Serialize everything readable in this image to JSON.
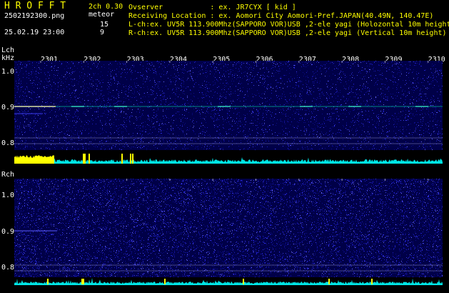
{
  "header": {
    "brand": "H R O F F T",
    "version": "2ch 0.30",
    "filename": "2502192300.png",
    "mode_label": "meteor",
    "count_lch": "15",
    "count_rch": "9",
    "datetime": "25.02.19 23:00"
  },
  "info": {
    "observer": "Ovserver           : ex. JR7CYX [ kid ]",
    "location": "Receiving Location : ex. Aomori City Aomori-Pref.JAPAN(40.49N, 140.47E)",
    "lch": "L-ch:ex. UV5R 113.900Mhz(SAPPORO VOR)USB ,2-ele yagi (Holozontal 10m height)",
    "rch": "R-ch:ex. UV5R 113.900Mhz(SAPPORO VOR)USB ,2-ele yagi (Vertical 10m height)"
  },
  "lch": {
    "label": "Lch",
    "unit": "kHz",
    "y_ticks": [
      "1.0",
      "0.9",
      "0.8"
    ]
  },
  "rch": {
    "label": "Rch",
    "y_ticks": [
      "1.0",
      "0.9",
      "0.8"
    ]
  },
  "time_axis": [
    "2301",
    "2302",
    "2303",
    "2304",
    "2305",
    "2306",
    "2307",
    "2308",
    "2309",
    "2310"
  ],
  "colors": {
    "green": "#00ff00",
    "yellow": "#ffff00",
    "cyan": "#00ffff",
    "background": "#000000",
    "spectrum_low": "#000060",
    "spectrum_high": "#2d2dff",
    "level_bar": "#00e5e5",
    "peak": "#ffff00",
    "echo_line": "#00c8a0"
  }
}
